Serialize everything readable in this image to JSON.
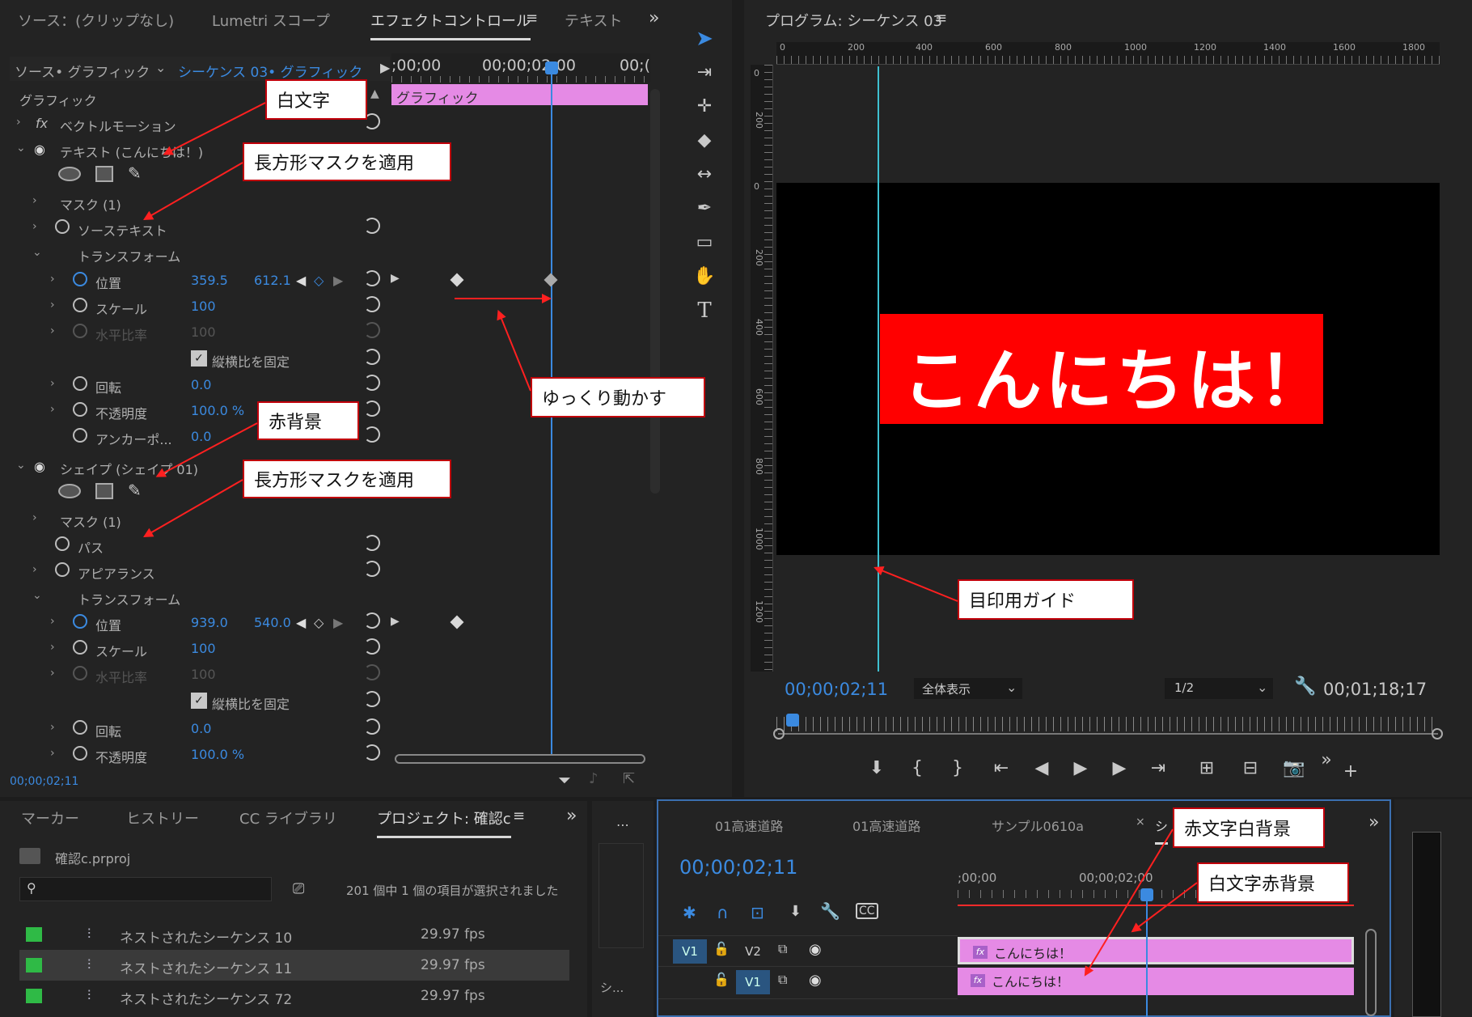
{
  "effect_controls": {
    "tabs": [
      "ソース：(クリップなし)",
      "Lumetri スコープ",
      "エフェクトコントロール",
      "テキスト"
    ],
    "active_tab": "エフェクトコントロール",
    "source_label": "ソース• グラフィック",
    "sequence_label": "シーケンス 03• グラフィック",
    "timecode_start": ";00;00",
    "timecode_mid": "00;00;02;00",
    "timecode_end": "00;(",
    "clip_label": "グラフィック",
    "section_graphic": "グラフィック",
    "vector_motion": "ベクトルモーション",
    "text_layer": "テキスト (こんにちは！)",
    "mask1": "マスク (1)",
    "source_text": "ソーステキスト",
    "transform": "トランスフォーム",
    "position": "位置",
    "pos1_x": "359.5",
    "pos1_y": "612.1",
    "scale": "スケール",
    "scale1": "100",
    "scale_width": "水平比率",
    "scale_width1": "100",
    "uniform_scale": "縦横比を固定",
    "rotation": "回転",
    "rot1": "0.0",
    "opacity": "不透明度",
    "opacity1": "100.0 %",
    "anchor": "アンカーポ...",
    "anchor1": "0.0",
    "shape_layer": "シェイプ (シェイプ 01)",
    "mask2": "マスク (1)",
    "path": "パス",
    "appearance": "アピアランス",
    "pos2_x": "939.0",
    "pos2_y": "540.0",
    "scale2": "100",
    "scale_width2": "100",
    "rot2": "0.0",
    "opacity2": "100.0 %",
    "footer_tc": "00;00;02;11"
  },
  "program": {
    "title": "プログラム: シーケンス 03",
    "ruler_labels": [
      "0",
      "200",
      "400",
      "600",
      "800",
      "1000",
      "1200",
      "1400",
      "1600",
      "1800"
    ],
    "vruler_labels": [
      "0",
      "200",
      "0",
      "200",
      "400",
      "600",
      "800",
      "1000",
      "1200"
    ],
    "overlay_text": "こんにちは！",
    "timecode": "00;00;02;11",
    "zoom": "全体表示",
    "resolution": "1/2",
    "duration": "00;01;18;17"
  },
  "project": {
    "tabs": [
      "マーカー",
      "ヒストリー",
      "CC ライブラリ",
      "プロジェクト: 確認c"
    ],
    "active_tab": "プロジェクト: 確認c",
    "file": "確認c.prproj",
    "selection_info": "201 個中 1 個の項目が選択されました",
    "items": [
      {
        "name": "ネストされたシーケンス 10",
        "fps": "29.97 fps"
      },
      {
        "name": "ネストされたシーケンス 11",
        "fps": "29.97 fps"
      },
      {
        "name": "ネストされたシーケンス 72",
        "fps": "29.97 fps"
      }
    ],
    "side_label": "シ..."
  },
  "timeline": {
    "tabs": [
      "01高速道路",
      "01高速道路",
      "サンプル0610a",
      "シ"
    ],
    "timecode": "00;00;02;11",
    "ruler_start": ";00;00",
    "ruler_mid": "00;00;02;00",
    "tracks": [
      {
        "left": "V1",
        "name": "V2",
        "clip": "こんにちは！"
      },
      {
        "left": "",
        "name": "V1",
        "clip": "こんにちは！"
      }
    ]
  },
  "annotations": {
    "white_text": "白文字",
    "rect_mask1": "長方形マスクを適用",
    "move_slowly": "ゆっくり動かす",
    "red_bg": "赤背景",
    "rect_mask2": "長方形マスクを適用",
    "guide": "目印用ガイド",
    "red_white": "赤文字白背景",
    "white_red": "白文字赤背景"
  }
}
